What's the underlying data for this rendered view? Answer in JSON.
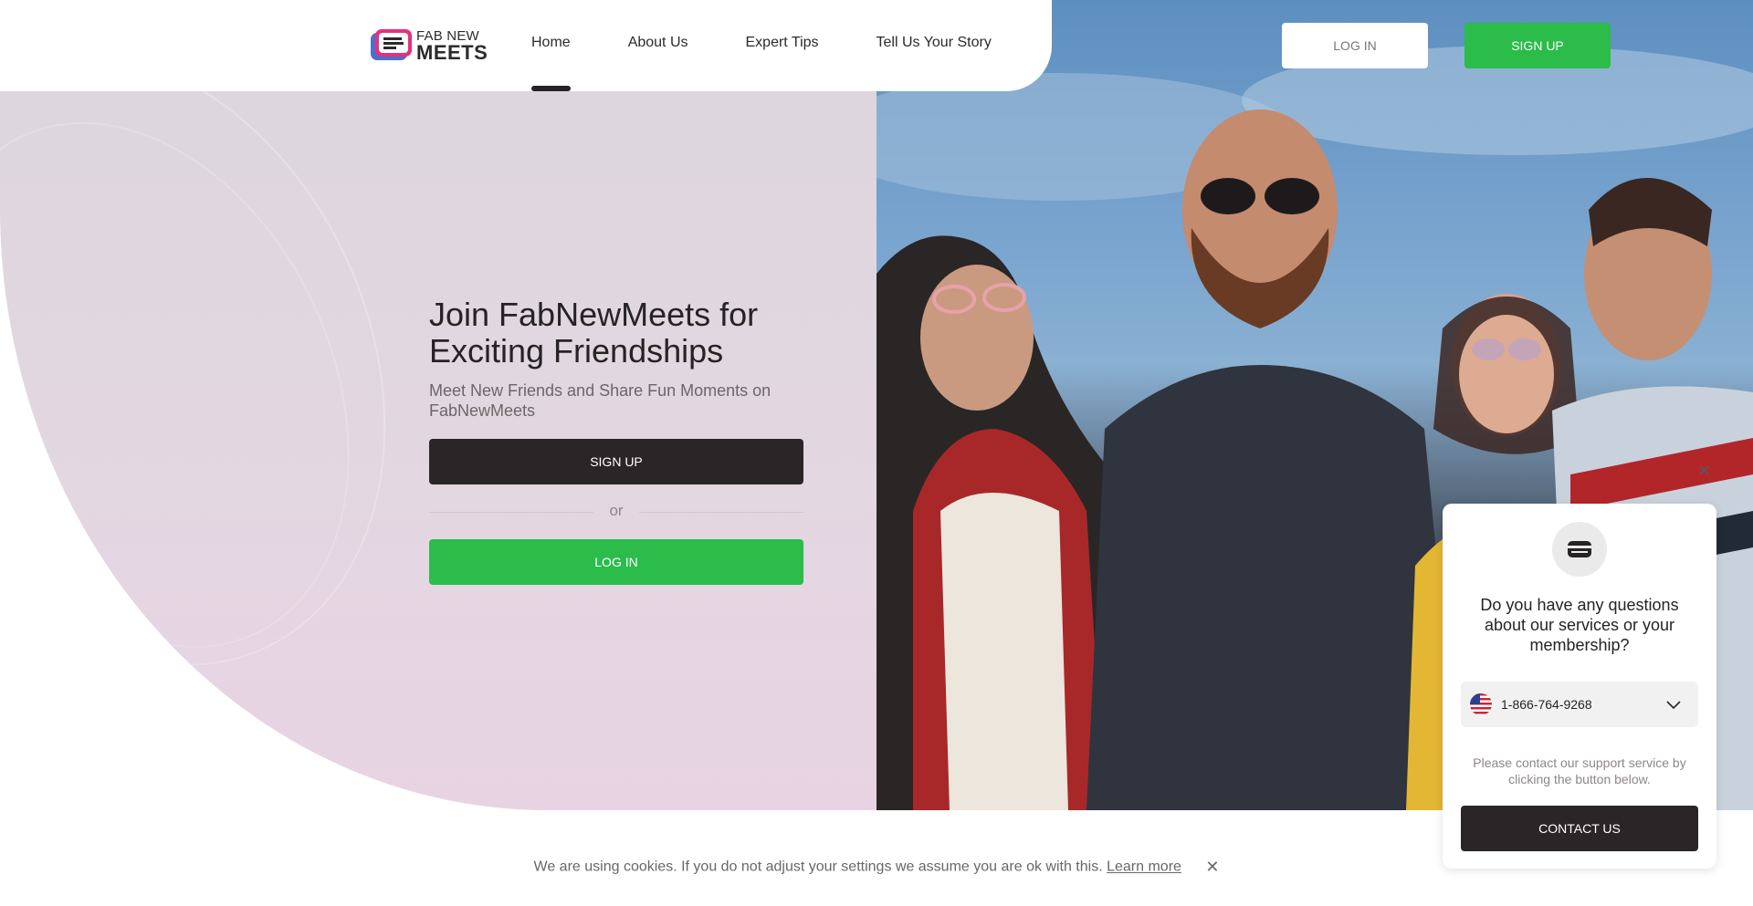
{
  "header": {
    "logo": {
      "line1": "FAB NEW",
      "line2": "MEETS"
    },
    "nav": [
      {
        "label": "Home",
        "active": true
      },
      {
        "label": "About Us"
      },
      {
        "label": "Expert Tips"
      },
      {
        "label": "Tell Us Your Story"
      }
    ],
    "login_label": "LOG IN",
    "signup_label": "SIGN UP"
  },
  "hero": {
    "title": "Join FabNewMeets for Exciting Friendships",
    "subtitle": "Meet New Friends and Share Fun Moments on FabNewMeets",
    "signup_label": "SIGN UP",
    "or_label": "or",
    "login_label": "LOG IN"
  },
  "support_widget": {
    "question": "Do you have any questions about our services or your membership?",
    "phone": "1-866-764-9268",
    "help_text": "Please contact our support service by clicking the button below.",
    "contact_label": "CONTACT US",
    "close_icon": "close-icon"
  },
  "cookie_bar": {
    "text": "We are using cookies. If you do not adjust your settings we assume you are ok with this.",
    "link_label": "Learn more",
    "close_icon": "close-icon"
  },
  "colors": {
    "accent_green": "#2bbc4a",
    "dark": "#2a2627",
    "hero_bg": "#e3d7e1"
  }
}
